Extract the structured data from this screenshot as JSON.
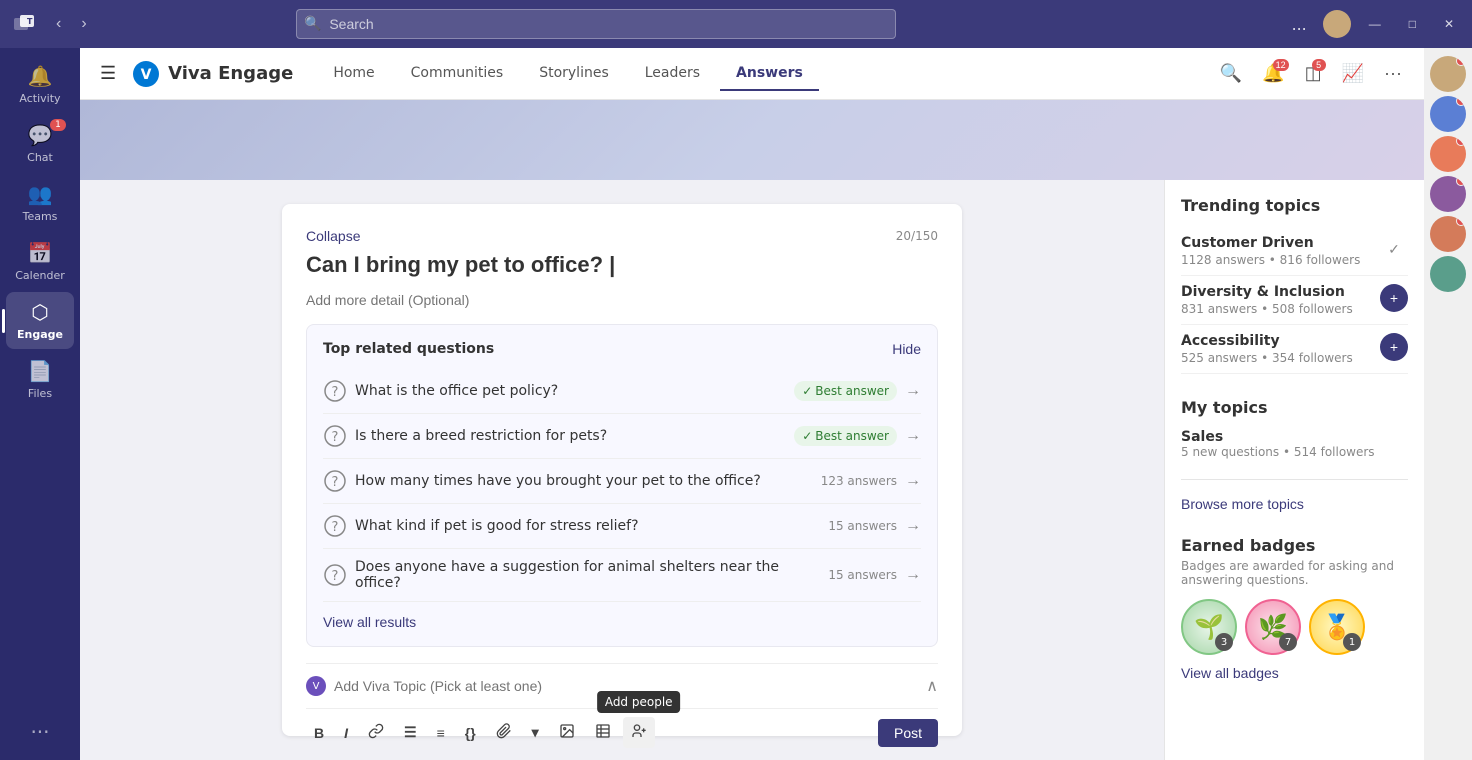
{
  "titlebar": {
    "search_placeholder": "Search",
    "dots_label": "...",
    "minimize": "—",
    "maximize": "□",
    "close": "✕"
  },
  "sidebar": {
    "items": [
      {
        "id": "activity",
        "label": "Activity",
        "icon": "🔔",
        "badge": null
      },
      {
        "id": "chat",
        "label": "Chat",
        "icon": "💬",
        "badge": "1"
      },
      {
        "id": "teams",
        "label": "Teams",
        "icon": "👥",
        "badge": null
      },
      {
        "id": "calendar",
        "label": "Calender",
        "icon": "📅",
        "badge": null
      },
      {
        "id": "engage",
        "label": "Engage",
        "icon": "⬡",
        "badge": null,
        "active": true
      },
      {
        "id": "files",
        "label": "Files",
        "icon": "📄",
        "badge": null
      }
    ],
    "more_label": "•••"
  },
  "app_header": {
    "hamburger": "☰",
    "logo_alt": "Viva Engage",
    "app_name": "Viva Engage",
    "nav": [
      {
        "id": "home",
        "label": "Home",
        "active": false
      },
      {
        "id": "communities",
        "label": "Communities",
        "active": false
      },
      {
        "id": "storylines",
        "label": "Storylines",
        "active": false
      },
      {
        "id": "leaders",
        "label": "Leaders",
        "active": false
      },
      {
        "id": "answers",
        "label": "Answers",
        "active": true
      }
    ],
    "header_icons": [
      {
        "id": "search",
        "icon": "🔍",
        "badge": null
      },
      {
        "id": "notifications",
        "icon": "🔔",
        "badge": "12"
      },
      {
        "id": "store",
        "icon": "🛒",
        "badge": "5"
      },
      {
        "id": "analytics",
        "icon": "📈",
        "badge": null
      },
      {
        "id": "more",
        "icon": "···",
        "badge": null
      }
    ]
  },
  "question_card": {
    "collapse_label": "Collapse",
    "char_count": "20/150",
    "question_placeholder": "Can I bring my pet to office? |",
    "detail_placeholder": "Add more detail (Optional)",
    "related_section": {
      "title": "Top related questions",
      "hide_label": "Hide",
      "questions": [
        {
          "text": "What is the office pet policy?",
          "badge": "Best answer",
          "has_best_answer": true,
          "answer_count": null
        },
        {
          "text": "Is there a breed restriction for pets?",
          "badge": "Best answer",
          "has_best_answer": true,
          "answer_count": null
        },
        {
          "text": "How many times have you brought your pet to the office?",
          "badge": null,
          "has_best_answer": false,
          "answer_count": "123 answers"
        },
        {
          "text": "What kind if pet is good for stress relief?",
          "badge": null,
          "has_best_answer": false,
          "answer_count": "15 answers"
        },
        {
          "text": "Does anyone have a suggestion for animal shelters near the office?",
          "badge": null,
          "has_best_answer": false,
          "answer_count": "15 answers"
        }
      ],
      "view_all": "View all results"
    },
    "topic_picker": {
      "placeholder": "Add Viva Topic (Pick at least one)"
    },
    "toolbar": {
      "bold": "B",
      "italic": "I",
      "link": "🔗",
      "list_bullets": "≡",
      "list_numbers": "≡",
      "code": "{}",
      "attach": "📎",
      "attach_arrow": "▾",
      "image": "🖼",
      "table": "⊞",
      "add_people": "👤",
      "add_people_tooltip": "Add people",
      "post": "Post"
    }
  },
  "right_panel": {
    "trending_title": "Trending topics",
    "trending_topics": [
      {
        "name": "Customer Driven",
        "answers": "1128 answers",
        "followers": "816 followers",
        "action": "check"
      },
      {
        "name": "Diversity & Inclusion",
        "answers": "831 answers",
        "followers": "508 followers",
        "action": "plus"
      },
      {
        "name": "Accessibility",
        "answers": "525 answers",
        "followers": "354 followers",
        "action": "plus"
      }
    ],
    "my_topics_title": "My topics",
    "my_topics": [
      {
        "name": "Sales",
        "meta": "5 new questions • 514 followers"
      }
    ],
    "browse_label": "Browse more topics",
    "badges_title": "Earned badges",
    "badges_desc": "Badges are awarded for asking and answering questions.",
    "badges": [
      {
        "emoji": "🌱",
        "count": "3",
        "color": "green"
      },
      {
        "emoji": "🌿",
        "count": "7",
        "color": "pink"
      },
      {
        "emoji": "🏅",
        "count": "1",
        "color": "yellow"
      }
    ],
    "view_badges_label": "View all badges"
  },
  "right_rail": {
    "avatars": [
      {
        "color": "#c8a87a"
      },
      {
        "color": "#5b7fd4"
      },
      {
        "color": "#e87b5a"
      },
      {
        "color": "#8b5a9e"
      },
      {
        "color": "#d47b5a"
      },
      {
        "color": "#5a9e8b"
      }
    ]
  }
}
